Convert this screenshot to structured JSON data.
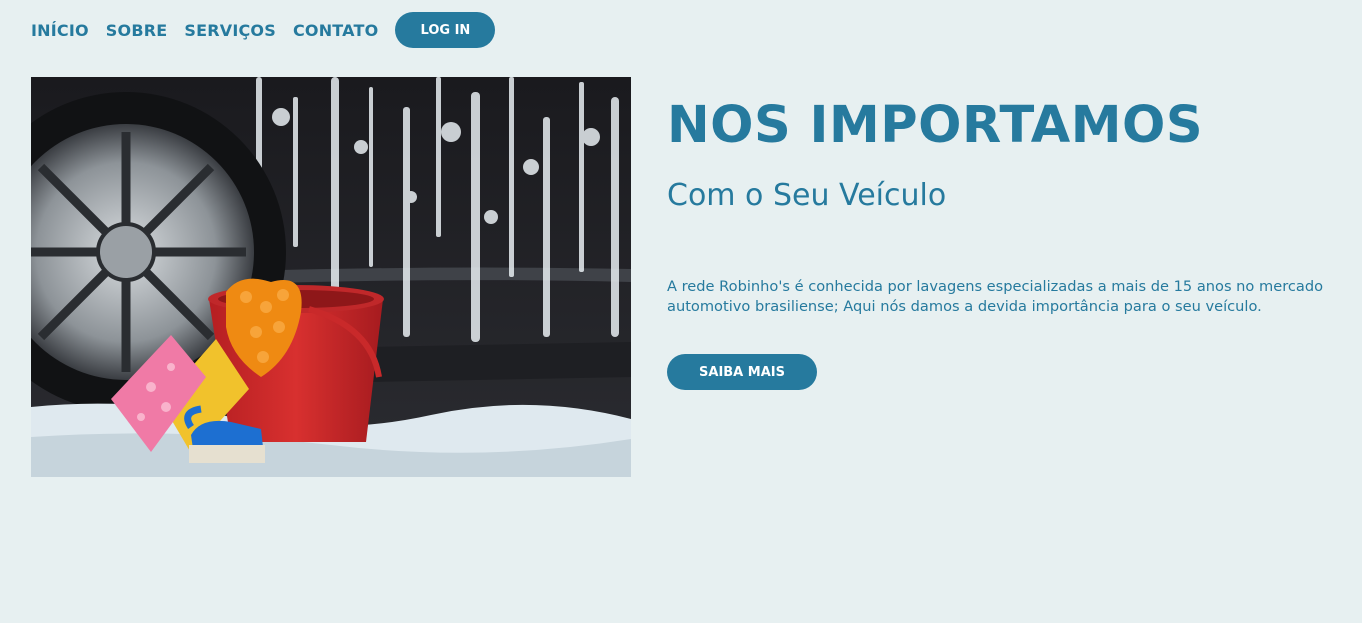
{
  "nav": {
    "links": [
      "INÍCIO",
      "SOBRE",
      "SERVIÇOS",
      "CONTATO"
    ],
    "login_label": "LOG IN"
  },
  "hero": {
    "image": "car-wash-photo",
    "title": "NOS IMPORTAMOS",
    "subtitle": "Com o Seu Veículo",
    "description": "A rede Robinho's é conhecida por lavagens especializadas a mais de 15 anos no mercado automotivo brasiliense; Aqui nós damos a devida importância para o seu veículo.",
    "cta_label": "SAIBA MAIS"
  },
  "colors": {
    "background": "#e7f0f1",
    "accent": "#267a9e",
    "button_text": "#ffffff"
  }
}
